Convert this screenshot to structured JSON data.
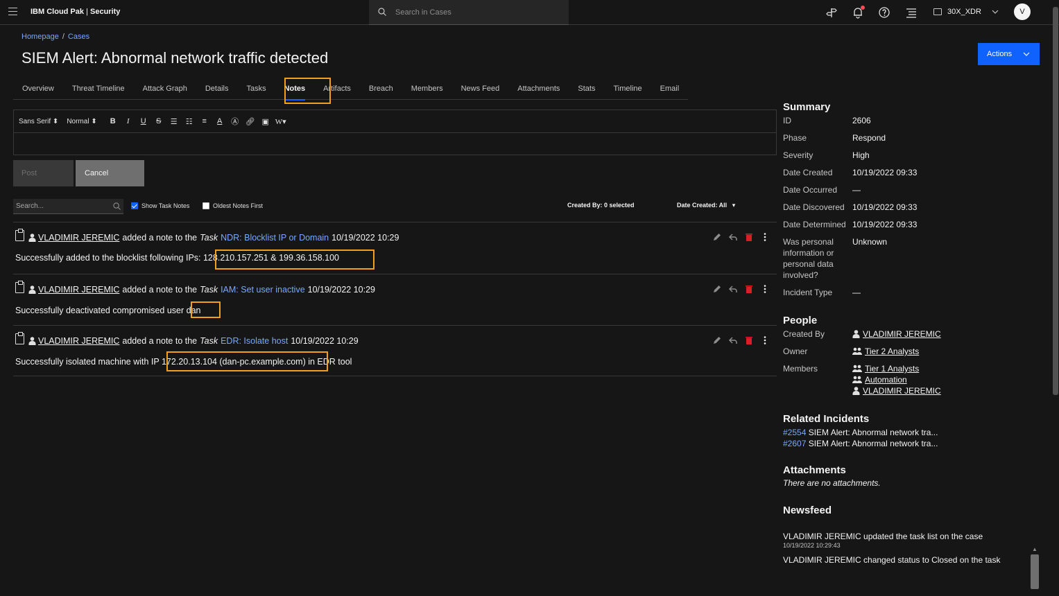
{
  "header": {
    "brand_bold": "IBM Cloud Pak",
    "brand_sep": " | ",
    "brand_light": "Security",
    "search_placeholder": "Search in Cases",
    "tenant": "30X_XDR",
    "avatar_initial": "V"
  },
  "breadcrumb": {
    "home": "Homepage",
    "sep": "/",
    "current": "Cases"
  },
  "page": {
    "title": "SIEM Alert: Abnormal network traffic detected",
    "actions_label": "Actions"
  },
  "tabs": [
    {
      "label": "Overview",
      "active": false
    },
    {
      "label": "Threat Timeline",
      "active": false
    },
    {
      "label": "Attack Graph",
      "active": false
    },
    {
      "label": "Details",
      "active": false
    },
    {
      "label": "Tasks",
      "active": false
    },
    {
      "label": "Notes",
      "active": true
    },
    {
      "label": "Artifacts",
      "active": false
    },
    {
      "label": "Breach",
      "active": false
    },
    {
      "label": "Members",
      "active": false
    },
    {
      "label": "News Feed",
      "active": false
    },
    {
      "label": "Attachments",
      "active": false
    },
    {
      "label": "Stats",
      "active": false
    },
    {
      "label": "Timeline",
      "active": false
    },
    {
      "label": "Email",
      "active": false
    }
  ],
  "editor": {
    "font_select": "Sans Serif",
    "size_select": "Normal",
    "post_label": "Post",
    "cancel_label": "Cancel"
  },
  "filters": {
    "search_placeholder": "Search...",
    "show_task_notes": "Show Task Notes",
    "oldest_first": "Oldest Notes First",
    "created_by": "Created By: 0 selected",
    "date_created": "Date Created: All"
  },
  "notes": [
    {
      "author": "VLADIMIR JEREMIC",
      "verb": "added a note to the",
      "kind": "Task",
      "task": "NDR: Blocklist IP or Domain",
      "time": "10/19/2022 10:29",
      "body_prefix": "Successfully added to the blocklist following IPs: ",
      "body_highlight": "128.210.157.251 & 199.36.158.100",
      "body_suffix": ""
    },
    {
      "author": "VLADIMIR JEREMIC",
      "verb": "added a note to the",
      "kind": "Task",
      "task": "IAM: Set user inactive",
      "time": "10/19/2022 10:29",
      "body_prefix": "Successfully deactivated compromised user ",
      "body_highlight": "dan",
      "body_suffix": ""
    },
    {
      "author": "VLADIMIR JEREMIC",
      "verb": "added a note to the",
      "kind": "Task",
      "task": "EDR: Isolate host",
      "time": "10/19/2022 10:29",
      "body_prefix": "Successfully isolated machine with IP ",
      "body_highlight": "172.20.13.104 (dan-pc.example.com)",
      "body_suffix": " in EDR tool"
    }
  ],
  "summary": {
    "heading": "Summary",
    "rows": [
      {
        "k": "ID",
        "v": "2606"
      },
      {
        "k": "Phase",
        "v": "Respond"
      },
      {
        "k": "Severity",
        "v": "High"
      },
      {
        "k": "Date Created",
        "v": "10/19/2022 09:33"
      },
      {
        "k": "Date Occurred",
        "v": "—"
      },
      {
        "k": "Date Discovered",
        "v": "10/19/2022 09:33"
      },
      {
        "k": "Date Determined",
        "v": "10/19/2022 09:33"
      },
      {
        "k": "Was personal information or personal data involved?",
        "v": "Unknown"
      },
      {
        "k": "Incident Type",
        "v": "—"
      }
    ]
  },
  "people": {
    "heading": "People",
    "created_by_label": "Created By",
    "created_by": "VLADIMIR JEREMIC",
    "owner_label": "Owner",
    "owner": "Tier 2 Analysts",
    "members_label": "Members",
    "members": [
      "Tier 1 Analysts",
      "Automation",
      "VLADIMIR JEREMIC"
    ]
  },
  "related": {
    "heading": "Related Incidents",
    "items": [
      {
        "num": "#2554",
        "title": "SIEM Alert: Abnormal network tra..."
      },
      {
        "num": "#2607",
        "title": "SIEM Alert: Abnormal network tra..."
      }
    ]
  },
  "attachments": {
    "heading": "Attachments",
    "empty": "There are no attachments."
  },
  "newsfeed": {
    "heading": "Newsfeed",
    "items": [
      {
        "text": "VLADIMIR JEREMIC updated the task list on the case",
        "time": "10/19/2022 10:29:43"
      },
      {
        "text": "VLADIMIR JEREMIC changed status to Closed on the task",
        "time": ""
      }
    ]
  },
  "colors": {
    "accent": "#0f62fe",
    "link": "#78a9ff",
    "highlight": "#f1a11e",
    "danger": "#da1e28"
  }
}
